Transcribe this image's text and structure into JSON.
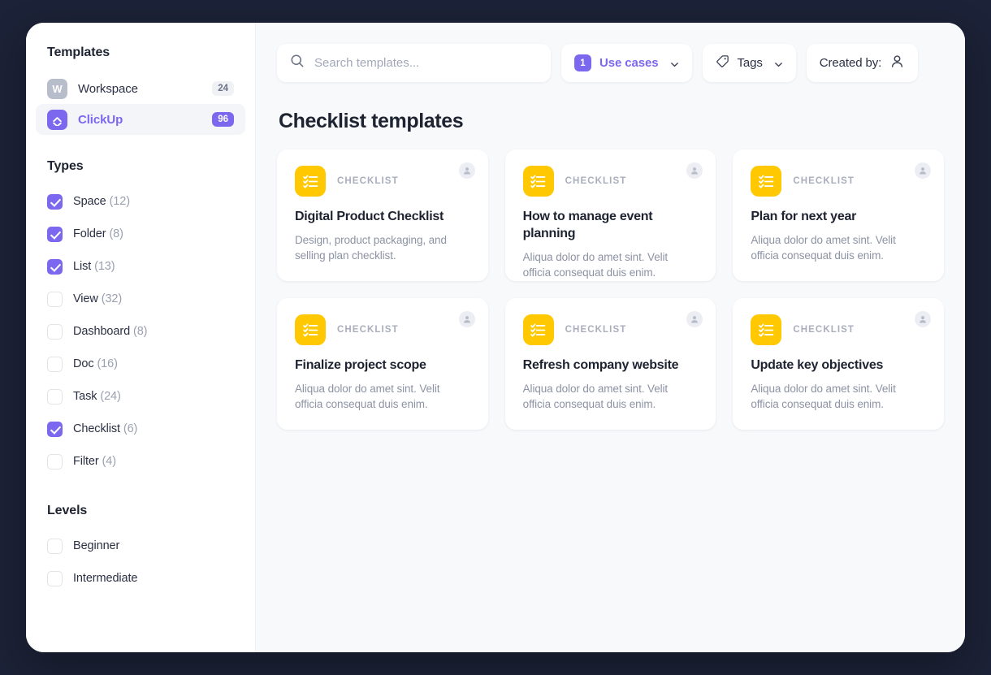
{
  "sidebar": {
    "templates_heading": "Templates",
    "sources": [
      {
        "icon": "workspace-icon",
        "glyph": "W",
        "label": "Workspace",
        "count": "24",
        "active": false
      },
      {
        "icon": "clickup-icon",
        "glyph": "",
        "label": "ClickUp",
        "count": "96",
        "active": true
      }
    ],
    "types_heading": "Types",
    "types": [
      {
        "label": "Space",
        "count": "(12)",
        "checked": true
      },
      {
        "label": "Folder",
        "count": "(8)",
        "checked": true
      },
      {
        "label": "List",
        "count": "(13)",
        "checked": true
      },
      {
        "label": "View",
        "count": "(32)",
        "checked": false
      },
      {
        "label": "Dashboard",
        "count": "(8)",
        "checked": false
      },
      {
        "label": "Doc",
        "count": "(16)",
        "checked": false
      },
      {
        "label": "Task",
        "count": "(24)",
        "checked": false
      },
      {
        "label": "Checklist",
        "count": "(6)",
        "checked": true
      },
      {
        "label": "Filter",
        "count": "(4)",
        "checked": false
      }
    ],
    "levels_heading": "Levels",
    "levels": [
      {
        "label": "Beginner",
        "count": "",
        "checked": false
      },
      {
        "label": "Intermediate",
        "count": "",
        "checked": false
      }
    ]
  },
  "toolbar": {
    "search_placeholder": "Search templates...",
    "search_value": "",
    "use_cases_label": "Use cases",
    "use_cases_count": "1",
    "tags_label": "Tags",
    "created_by_label": "Created by:"
  },
  "main": {
    "page_title": "Checklist templates",
    "cards": [
      {
        "type": "CHECKLIST",
        "title": "Digital Product Checklist",
        "desc": "Design, product packaging, and selling plan checklist."
      },
      {
        "type": "CHECKLIST",
        "title": "How to manage event planning",
        "desc": "Aliqua dolor do amet sint. Velit officia consequat duis enim."
      },
      {
        "type": "CHECKLIST",
        "title": "Plan for next year",
        "desc": "Aliqua dolor do amet sint. Velit officia consequat duis enim."
      },
      {
        "type": "CHECKLIST",
        "title": "Finalize project scope",
        "desc": "Aliqua dolor do amet sint. Velit officia consequat duis enim."
      },
      {
        "type": "CHECKLIST",
        "title": "Refresh company website",
        "desc": "Aliqua dolor do amet sint. Velit officia consequat duis enim."
      },
      {
        "type": "CHECKLIST",
        "title": "Update key objectives",
        "desc": "Aliqua dolor do amet sint. Velit officia consequat duis enim."
      }
    ]
  },
  "colors": {
    "accent": "#7b68ee",
    "checklist_yellow": "#ffc800",
    "page_bg": "#1c2237",
    "panel_bg": "#f8f9fb"
  }
}
